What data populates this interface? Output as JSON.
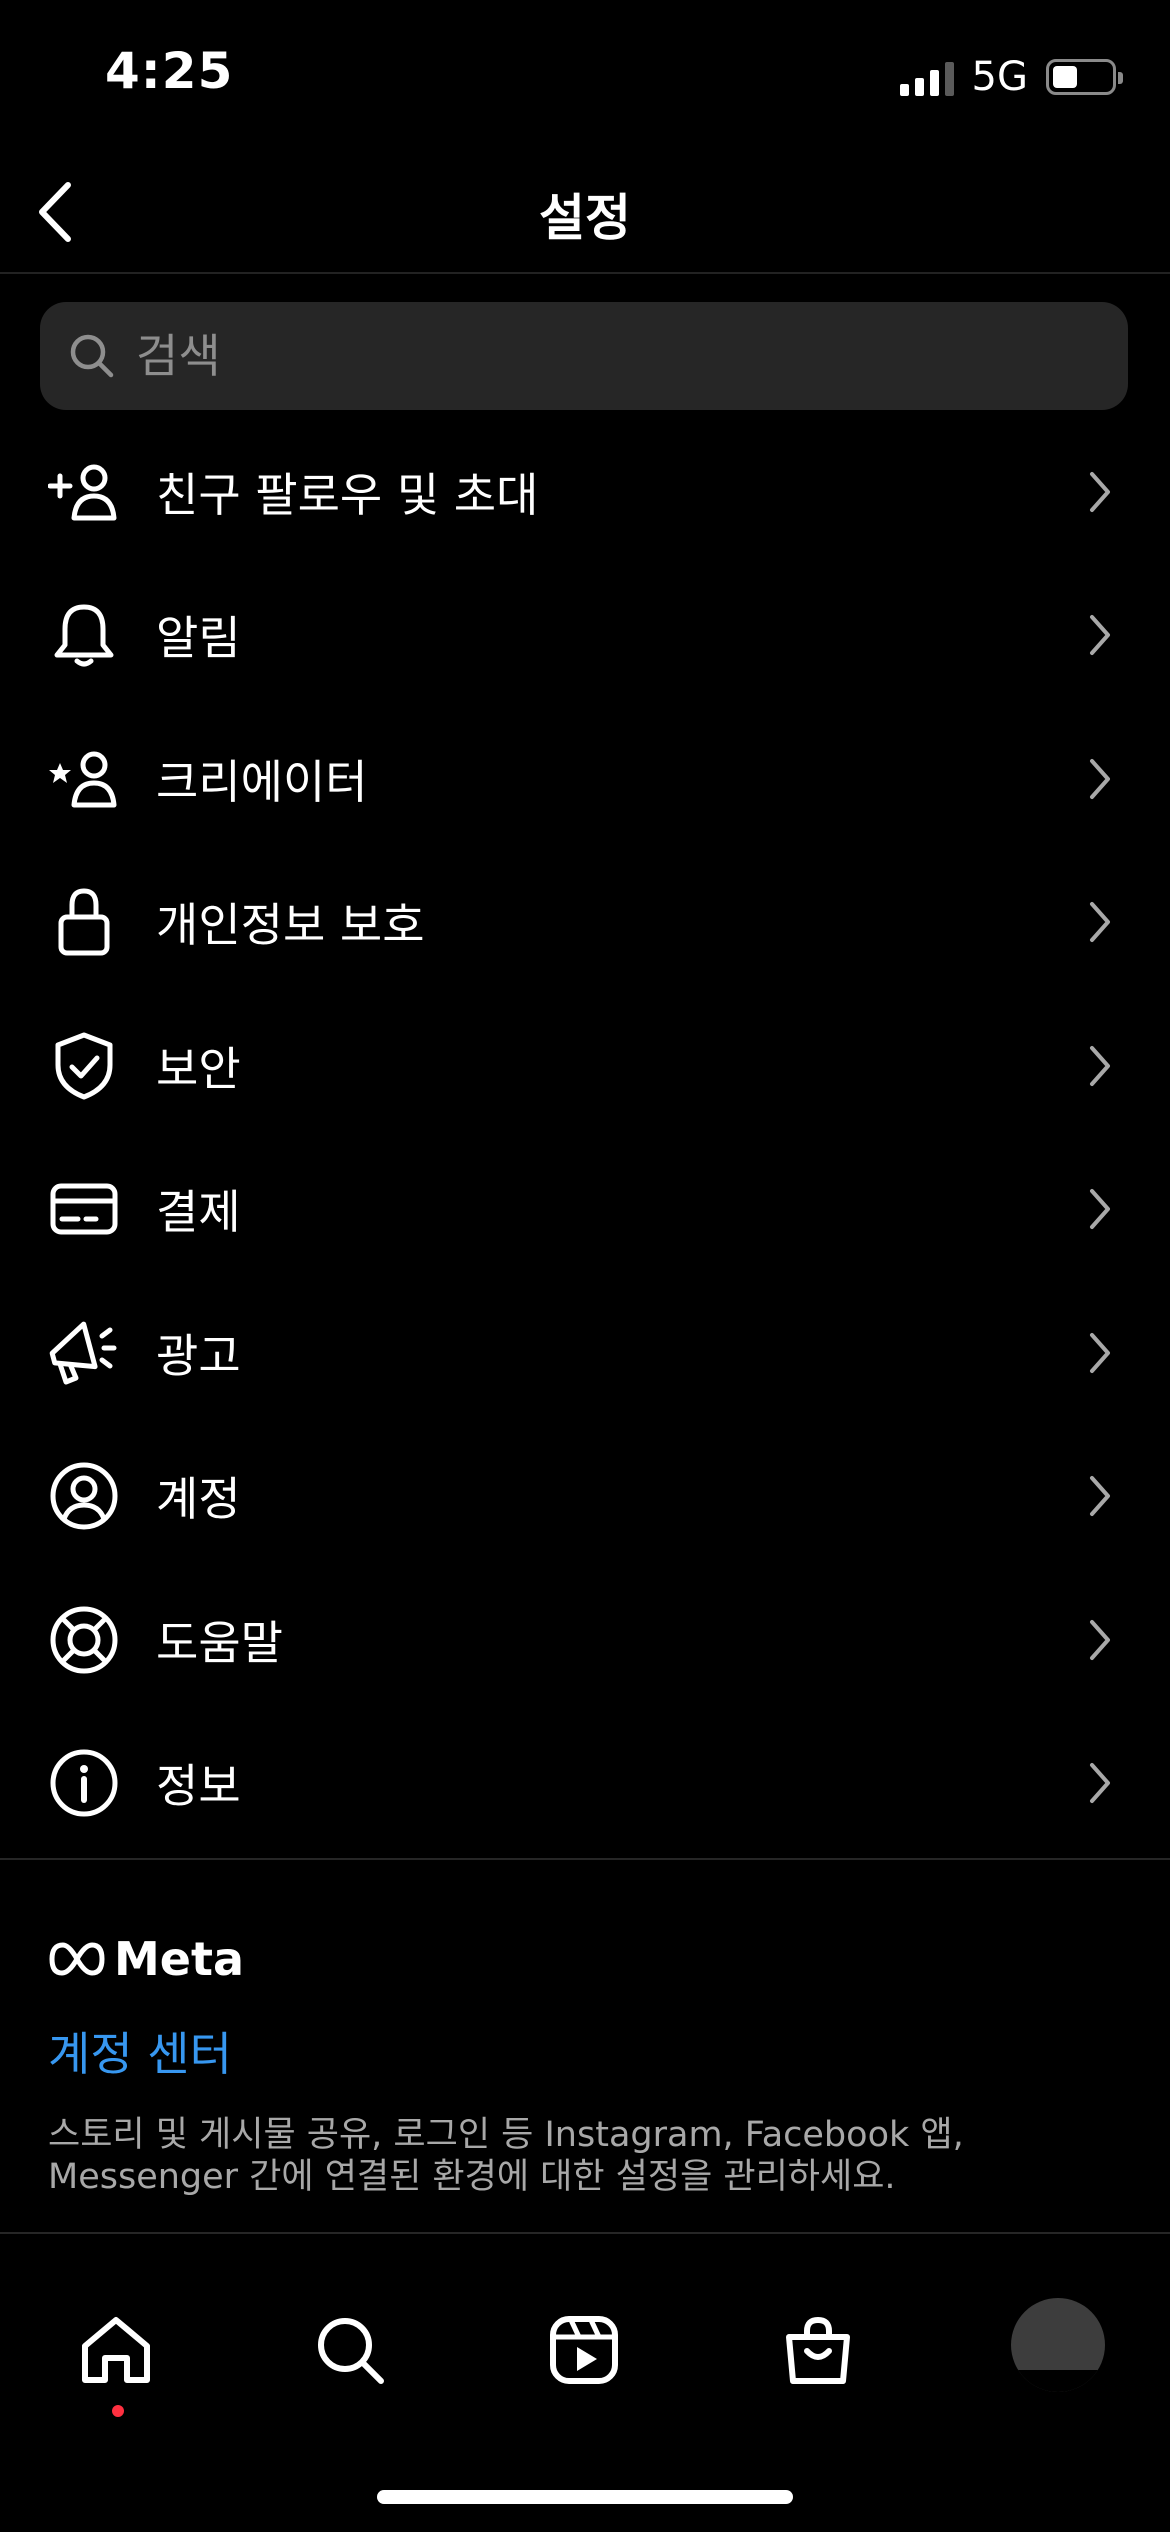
{
  "status_bar": {
    "time": "4:25",
    "network": "5G"
  },
  "header": {
    "title": "설정",
    "back_icon": "chevron-left-icon"
  },
  "search": {
    "placeholder": "검색",
    "value": ""
  },
  "menu": [
    {
      "label": "친구 팔로우 및 초대",
      "icon": "add-person-icon"
    },
    {
      "label": "알림",
      "icon": "bell-icon"
    },
    {
      "label": "크리에이터",
      "icon": "creator-star-person-icon"
    },
    {
      "label": "개인정보 보호",
      "icon": "lock-icon"
    },
    {
      "label": "보안",
      "icon": "shield-check-icon"
    },
    {
      "label": "결제",
      "icon": "credit-card-icon"
    },
    {
      "label": "광고",
      "icon": "megaphone-icon"
    },
    {
      "label": "계정",
      "icon": "account-circle-icon"
    },
    {
      "label": "도움말",
      "icon": "lifebuoy-icon"
    },
    {
      "label": "정보",
      "icon": "info-icon"
    }
  ],
  "meta": {
    "brand": "Meta",
    "accounts_center": "계정 센터",
    "description": "스토리 및 게시물 공유, 로그인 등 Instagram, Facebook 앱, Messenger 간에 연결된 환경에 대한 설정을 관리하세요."
  },
  "tab_bar": {
    "tabs": [
      "home-icon",
      "search-icon",
      "reels-icon",
      "shop-icon",
      "profile-avatar"
    ],
    "active": "home-icon"
  },
  "colors": {
    "background": "#000000",
    "accent_link": "#3797f0",
    "notification_dot": "#ff3040"
  }
}
